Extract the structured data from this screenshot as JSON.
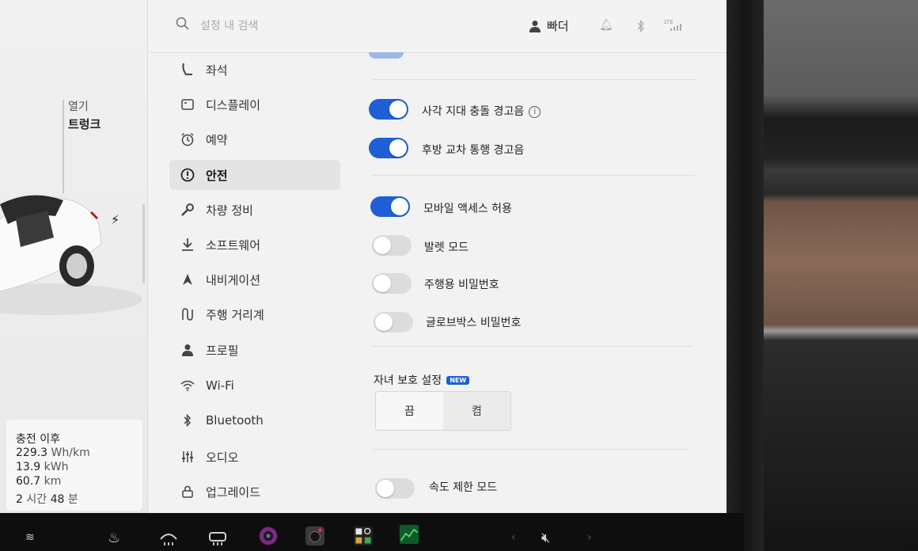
{
  "header": {
    "search_placeholder": "설정 내 검색",
    "user_name": "빠더",
    "network": "LTE"
  },
  "vehicle": {
    "open_label": "열기",
    "trunk_label": "트렁크"
  },
  "trip": {
    "title": "충전 이후",
    "energy_per_km": "229.3",
    "energy_per_km_unit": "Wh/km",
    "energy": "13.9",
    "energy_unit": "kWh",
    "distance": "60.7",
    "distance_unit": "km",
    "hours": "2",
    "hours_unit": "시간",
    "minutes": "48",
    "minutes_unit": "분"
  },
  "menu": {
    "items": [
      {
        "label": "좌석",
        "icon": "seat-icon"
      },
      {
        "label": "디스플레이",
        "icon": "display-icon"
      },
      {
        "label": "예약",
        "icon": "alarm-clock-icon"
      },
      {
        "label": "안전",
        "icon": "alert-circle-icon",
        "active": true
      },
      {
        "label": "차량 정비",
        "icon": "wrench-icon"
      },
      {
        "label": "소프트웨어",
        "icon": "download-icon"
      },
      {
        "label": "내비게이션",
        "icon": "navigation-arrow-icon"
      },
      {
        "label": "주행 거리계",
        "icon": "trip-route-icon"
      },
      {
        "label": "프로필",
        "icon": "person-icon"
      },
      {
        "label": "Wi-Fi",
        "icon": "wifi-icon"
      },
      {
        "label": "Bluetooth",
        "icon": "bluetooth-icon"
      },
      {
        "label": "오디오",
        "icon": "equalizer-icon"
      },
      {
        "label": "업그레이드",
        "icon": "lock-icon"
      }
    ]
  },
  "safety": {
    "blind_spot_label": "사각 지대 충돌 경고음",
    "blind_spot_on": true,
    "rear_cross_label": "후방 교차 통행 경고음",
    "rear_cross_on": true,
    "mobile_access_label": "모바일 액세스 허용",
    "mobile_access_on": true,
    "valet_label": "발렛 모드",
    "valet_on": false,
    "drive_pin_label": "주행용 비밀번호",
    "drive_pin_on": false,
    "glovebox_pin_label": "글로브박스 비밀번호",
    "glovebox_pin_on": false,
    "child_lock_title": "자녀 보호 설정",
    "new_badge": "NEW",
    "child_lock_off": "끔",
    "child_lock_on": "켬",
    "child_lock_selected": "끔",
    "speed_limit_label": "속도 제한 모드",
    "speed_limit_on": false
  },
  "colors": {
    "accent": "#1f5fd6",
    "toggle_off": "#dcdcdc",
    "screen_bg": "#f2f2f2"
  }
}
